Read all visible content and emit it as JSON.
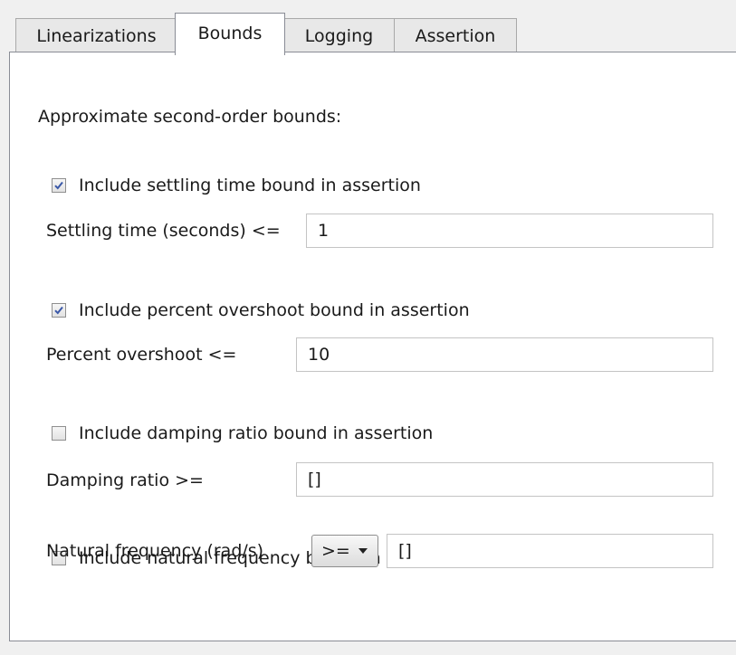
{
  "tabs": [
    {
      "label": "Linearizations",
      "active": false
    },
    {
      "label": "Bounds",
      "active": true
    },
    {
      "label": "Logging",
      "active": false
    },
    {
      "label": "Assertion",
      "active": false
    }
  ],
  "bounds": {
    "heading": "Approximate second-order bounds:",
    "settling": {
      "checkbox_label": "Include settling time bound in assertion",
      "checked": true,
      "field_label": "Settling time (seconds) <=",
      "value": "1"
    },
    "overshoot": {
      "checkbox_label": "Include percent overshoot bound in assertion",
      "checked": true,
      "field_label": "Percent overshoot <=",
      "value": "10"
    },
    "damping": {
      "checkbox_label": "Include damping ratio bound in assertion",
      "checked": false,
      "field_label": "Damping ratio >=",
      "value": "[]"
    },
    "frequency": {
      "checkbox_label": "Include natural frequency bound in assertion",
      "checked": false,
      "field_label": "Natural frequency (rad/s)",
      "operator": ">=",
      "value": "[]"
    }
  }
}
